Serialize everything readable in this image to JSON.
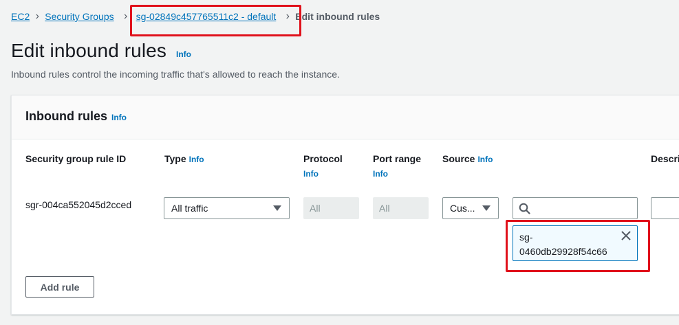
{
  "breadcrumb": {
    "items": [
      "EC2",
      "Security Groups",
      "sg-02849c457765511c2 - default"
    ],
    "current": "Edit inbound rules"
  },
  "page": {
    "title": "Edit inbound rules",
    "info": "Info",
    "description": "Inbound rules control the incoming traffic that's allowed to reach the instance."
  },
  "panel": {
    "title": "Inbound rules",
    "info": "Info"
  },
  "columns": {
    "rule_id": "Security group rule ID",
    "type": "Type",
    "type_info": "Info",
    "protocol": "Protocol",
    "protocol_info": "Info",
    "port_range": "Port range",
    "port_range_info": "Info",
    "source": "Source",
    "source_info": "Info",
    "description": "Descri"
  },
  "rule": {
    "id": "sgr-004ca552045d2cced",
    "type_value": "All traffic",
    "protocol_value": "All",
    "port_range_value": "All",
    "source_value": "Cus...",
    "search_value": "",
    "token_line1": "sg-",
    "token_line2": "0460db29928f54c66"
  },
  "buttons": {
    "add_rule": "Add rule"
  },
  "colors": {
    "link": "#0073bb",
    "highlight": "#e0111b",
    "token_bg": "#f1faff"
  },
  "icons": [
    "chevron-right-icon",
    "caret-down-icon",
    "search-icon",
    "close-icon"
  ]
}
